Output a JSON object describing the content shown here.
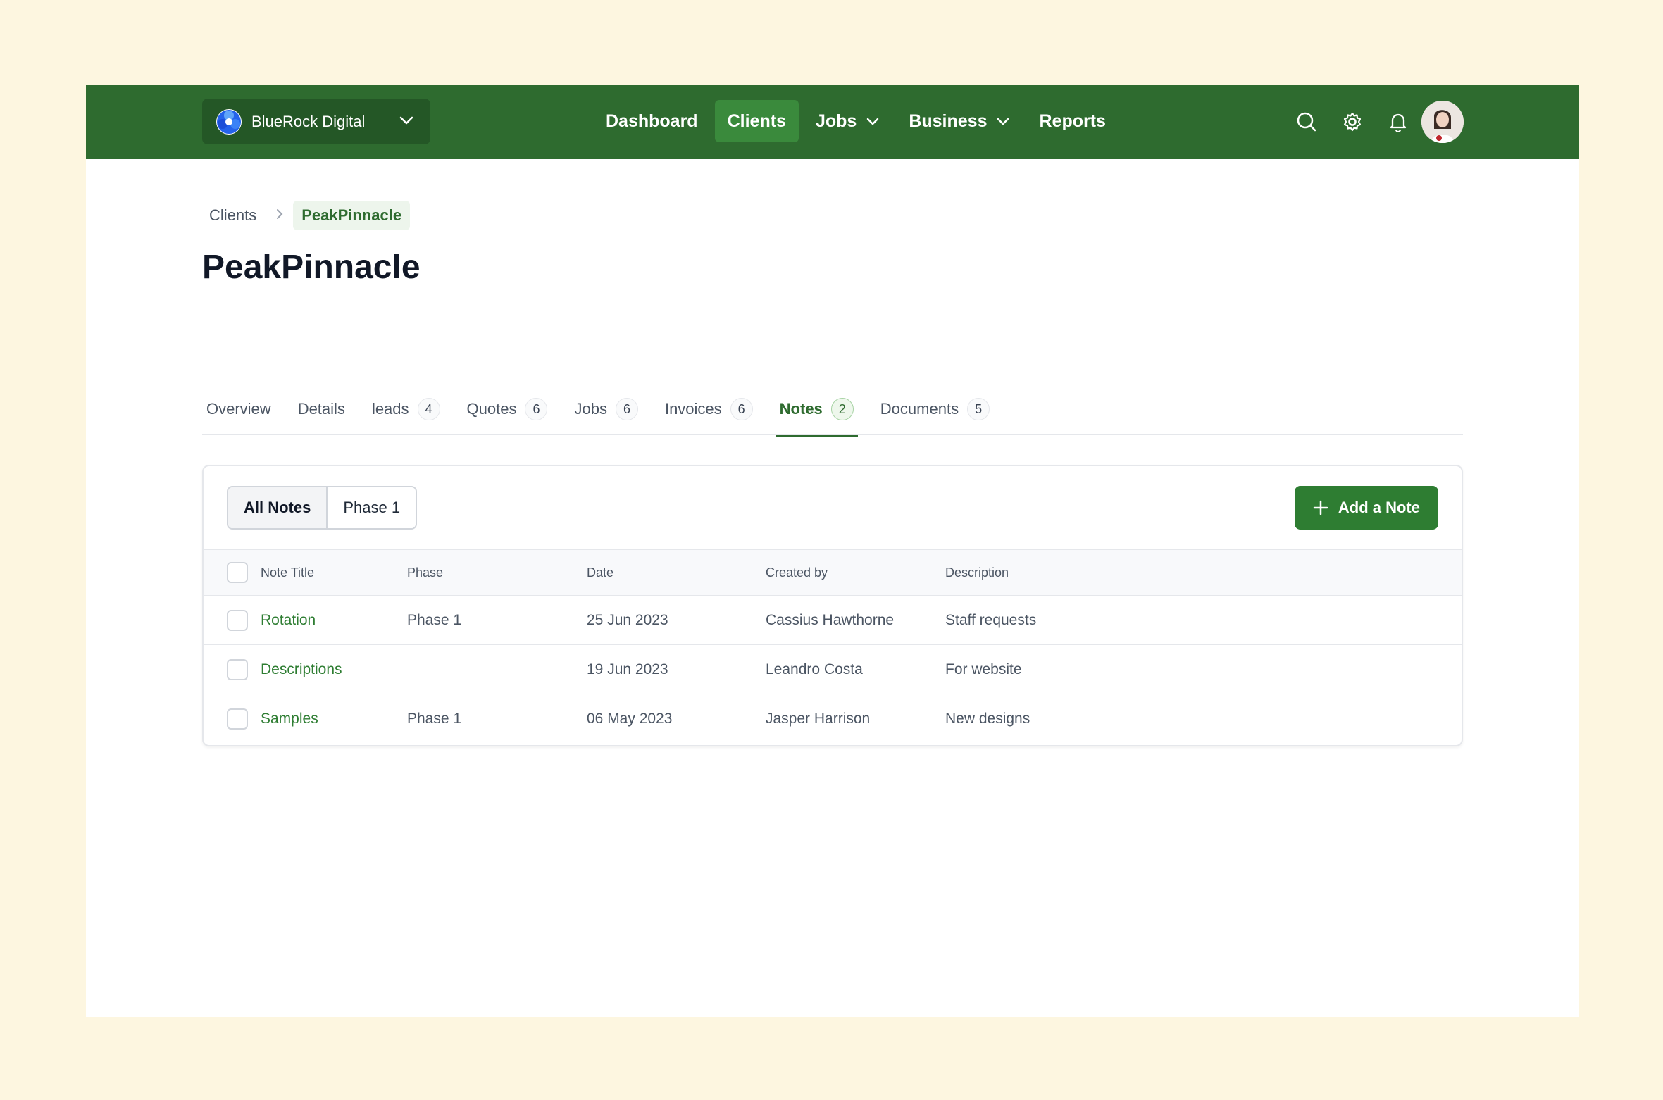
{
  "org": {
    "name": "BlueRock Digital"
  },
  "nav": {
    "items": [
      {
        "label": "Dashboard"
      },
      {
        "label": "Clients"
      },
      {
        "label": "Jobs"
      },
      {
        "label": "Business"
      },
      {
        "label": "Reports"
      }
    ]
  },
  "breadcrumb": {
    "parent": "Clients",
    "current": "PeakPinnacle"
  },
  "page": {
    "title": "PeakPinnacle"
  },
  "tabs": [
    {
      "label": "Overview",
      "count": ""
    },
    {
      "label": "Details",
      "count": ""
    },
    {
      "label": "leads",
      "count": "4"
    },
    {
      "label": "Quotes",
      "count": "6"
    },
    {
      "label": "Jobs",
      "count": "6"
    },
    {
      "label": "Invoices",
      "count": "6"
    },
    {
      "label": "Notes",
      "count": "2"
    },
    {
      "label": "Documents",
      "count": "5"
    }
  ],
  "filters": {
    "all": "All Notes",
    "phase": "Phase 1"
  },
  "actions": {
    "add_note": "Add a Note"
  },
  "table": {
    "headers": {
      "title": "Note Title",
      "phase": "Phase",
      "date": "Date",
      "created_by": "Created by",
      "description": "Description"
    },
    "rows": [
      {
        "title": "Rotation",
        "phase": "Phase 1",
        "date": "25 Jun 2023",
        "created_by": "Cassius Hawthorne",
        "description": "Staff requests"
      },
      {
        "title": "Descriptions",
        "phase": "",
        "date": "19 Jun 2023",
        "created_by": "Leandro Costa",
        "description": "For website"
      },
      {
        "title": "Samples",
        "phase": "Phase 1",
        "date": "06 May 2023",
        "created_by": "Jasper Harrison",
        "description": "New designs"
      }
    ]
  },
  "colors": {
    "brand": "#2e6b2f",
    "brand_dark": "#245726",
    "background": "#fdf6e0",
    "link": "#2e7d32"
  }
}
